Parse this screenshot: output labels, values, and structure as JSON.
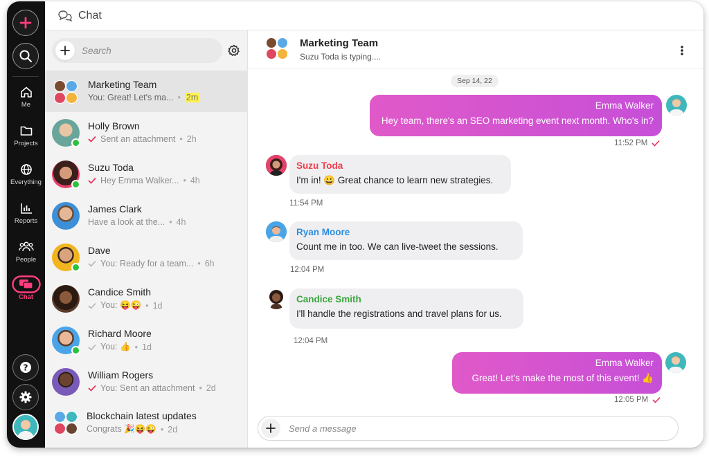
{
  "app": {
    "title": "Chat",
    "accent": "#ff3d7f",
    "online_color": "#2cc13d"
  },
  "rail": {
    "top": [
      {
        "name": "add-button",
        "icon": "plus-icon"
      },
      {
        "name": "search-button",
        "icon": "search-icon"
      }
    ],
    "items": [
      {
        "label": "Me",
        "icon": "home-icon"
      },
      {
        "label": "Projects",
        "icon": "folder-icon"
      },
      {
        "label": "Everything",
        "icon": "globe-icon"
      },
      {
        "label": "Reports",
        "icon": "bar-chart-icon"
      },
      {
        "label": "People",
        "icon": "people-icon"
      },
      {
        "label": "Chat",
        "icon": "chat-bubbles-icon",
        "active": true
      }
    ],
    "bottom": [
      {
        "name": "help-button",
        "icon": "question-icon"
      },
      {
        "name": "settings-button",
        "icon": "gear-icon"
      }
    ]
  },
  "search": {
    "placeholder": "Search"
  },
  "chats": [
    {
      "name": "Marketing Team",
      "preview": "You: Great! Let's ma...",
      "time": "2m",
      "selected": true,
      "group": true,
      "highlight_time": true
    },
    {
      "name": "Holly Brown",
      "preview": "Sent an attachment",
      "time": "2h",
      "online": true,
      "check": "red"
    },
    {
      "name": "Suzu Toda",
      "preview": "Hey Emma Walker...",
      "time": "4h",
      "online": true,
      "check": "red"
    },
    {
      "name": "James Clark",
      "preview": "Have a look at the...",
      "time": "4h"
    },
    {
      "name": "Dave",
      "preview": "You: Ready for a team...",
      "time": "6h",
      "online": true,
      "check": "grey"
    },
    {
      "name": "Candice Smith",
      "preview": "You: 😝😜",
      "time": "1d",
      "check": "grey"
    },
    {
      "name": "Richard Moore",
      "preview": "You: 👍",
      "time": "1d",
      "online": true,
      "check": "grey"
    },
    {
      "name": "William Rogers",
      "preview": "You: Sent an attachment",
      "time": "2d",
      "check": "red"
    },
    {
      "name": "Blockchain latest updates",
      "preview": "Congrats 🎉😝😜",
      "time": "2d",
      "group": true
    }
  ],
  "conversation": {
    "title": "Marketing Team",
    "status": "Suzu Toda is typing....",
    "date": "Sep 14, 22",
    "messages": [
      {
        "from": "Emma Walker",
        "text": "Hey team, there's an SEO marketing event next month. Who's in?",
        "time": "11:52 PM",
        "outgoing": true
      },
      {
        "from": "Suzu Toda",
        "text": "I'm in! 😀 Great chance to learn new strategies.",
        "time": "11:54 PM",
        "name_color": "#f03c4a"
      },
      {
        "from": "Ryan Moore",
        "text": "Count me in too. We can live-tweet the sessions.",
        "time": "12:04 PM",
        "name_color": "#2c8de0"
      },
      {
        "from": "Candice Smith",
        "text": "I'll handle the registrations and travel plans for us.",
        "time": "12:04 PM",
        "name_color": "#3aa63a"
      },
      {
        "from": "Emma Walker",
        "text": "Great! Let's make the most of this event! 👍",
        "time": "12:05 PM",
        "outgoing": true
      }
    ]
  },
  "composer": {
    "placeholder": "Send a message"
  }
}
